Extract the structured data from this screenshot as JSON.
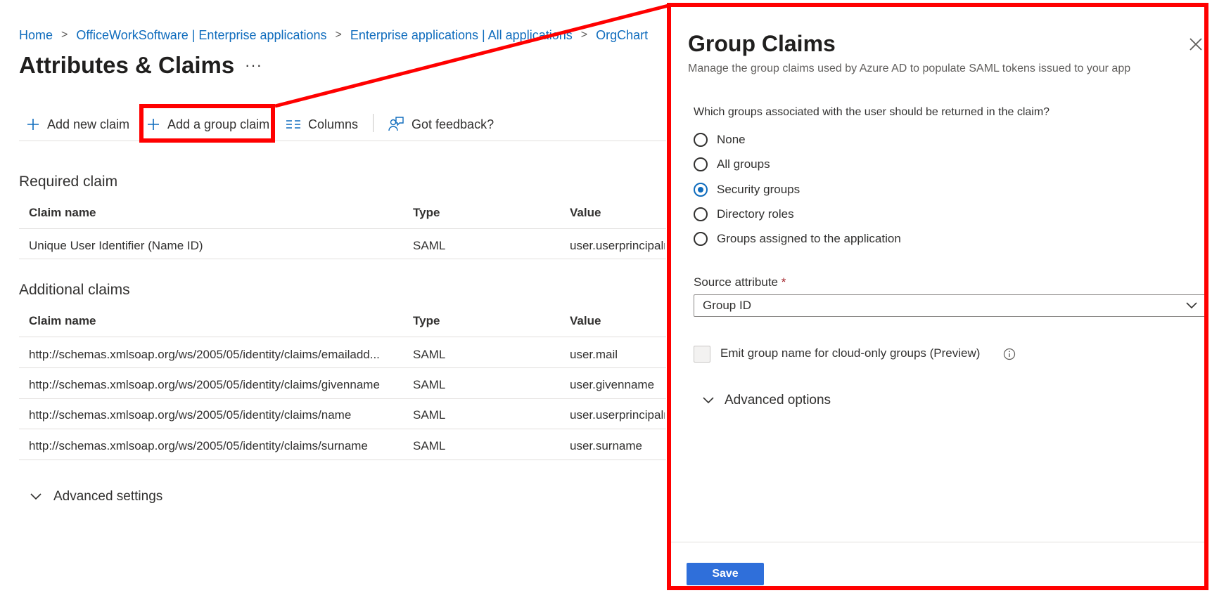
{
  "breadcrumb": {
    "items": [
      "Home",
      "OfficeWorkSoftware | Enterprise applications",
      "Enterprise applications | All applications",
      "OrgChart"
    ]
  },
  "page": {
    "title": "Attributes & Claims",
    "more": "···"
  },
  "toolbar": {
    "add_new_claim": "Add new claim",
    "add_group_claim": "Add a group claim",
    "columns": "Columns",
    "feedback": "Got feedback?"
  },
  "required": {
    "title": "Required claim",
    "headers": [
      "Claim name",
      "Type",
      "Value"
    ],
    "rows": [
      [
        "Unique User Identifier (Name ID)",
        "SAML",
        "user.userprincipalname"
      ]
    ]
  },
  "additional": {
    "title": "Additional claims",
    "headers": [
      "Claim name",
      "Type",
      "Value"
    ],
    "rows": [
      [
        "http://schemas.xmlsoap.org/ws/2005/05/identity/claims/emailadd...",
        "SAML",
        "user.mail"
      ],
      [
        "http://schemas.xmlsoap.org/ws/2005/05/identity/claims/givenname",
        "SAML",
        "user.givenname"
      ],
      [
        "http://schemas.xmlsoap.org/ws/2005/05/identity/claims/name",
        "SAML",
        "user.userprincipalname"
      ],
      [
        "http://schemas.xmlsoap.org/ws/2005/05/identity/claims/surname",
        "SAML",
        "user.surname"
      ]
    ]
  },
  "advanced_settings": "Advanced settings",
  "panel": {
    "title": "Group Claims",
    "subtitle": "Manage the group claims used by Azure AD to populate SAML tokens issued to your app",
    "question": "Which groups associated with the user should be returned in the claim?",
    "options": [
      {
        "label": "None",
        "checked": false
      },
      {
        "label": "All groups",
        "checked": false
      },
      {
        "label": "Security groups",
        "checked": true
      },
      {
        "label": "Directory roles",
        "checked": false
      },
      {
        "label": "Groups assigned to the application",
        "checked": false
      }
    ],
    "source_attribute_label": "Source attribute",
    "required_marker": "*",
    "source_attribute_value": "Group ID",
    "emit_label": "Emit group name for cloud-only groups (Preview)",
    "advanced_options": "Advanced options",
    "save": "Save"
  },
  "colors": {
    "link": "#0f6cbd",
    "highlight": "#ff0000",
    "primary": "#2f6fda"
  }
}
